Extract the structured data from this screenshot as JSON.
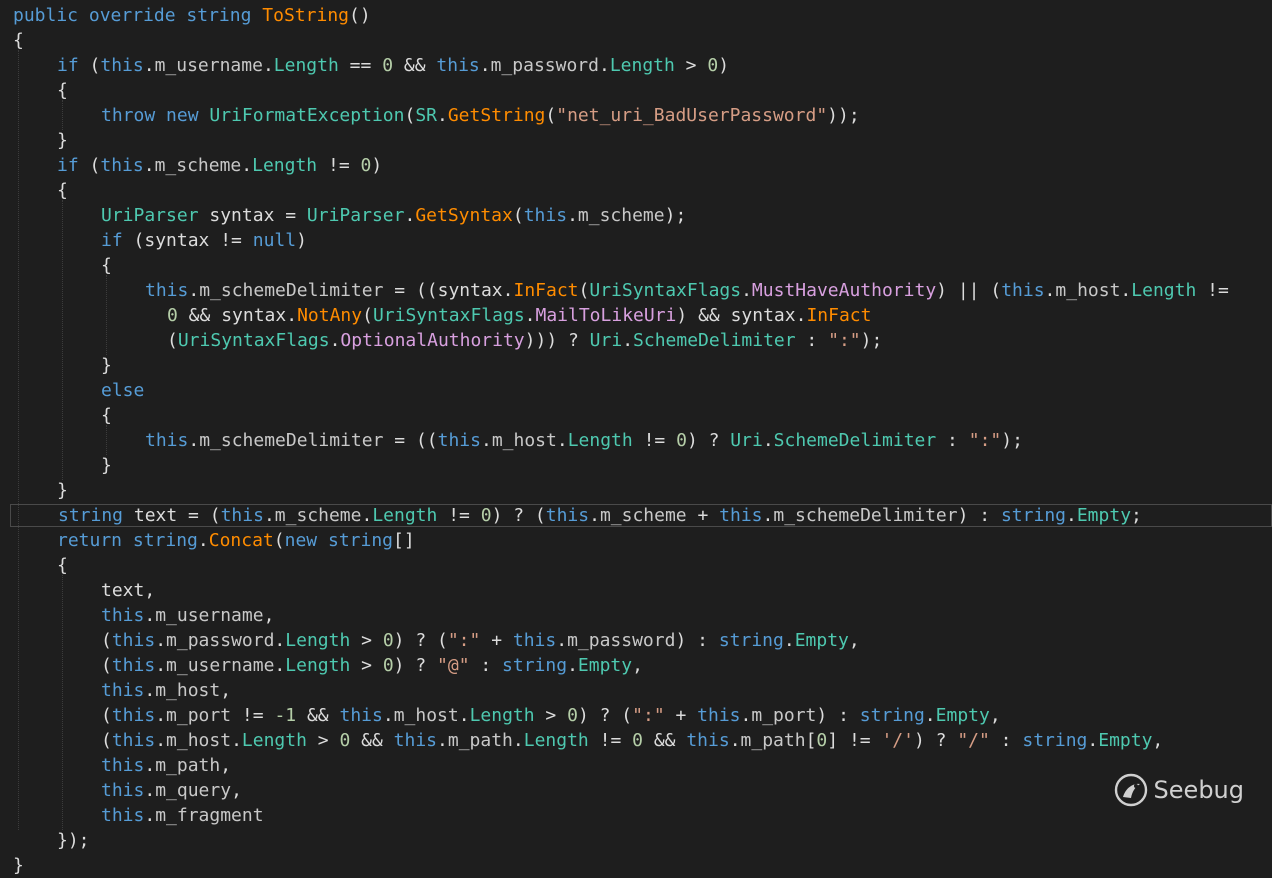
{
  "editor": {
    "current_line": 20,
    "lines": [
      {
        "indent": 0,
        "tokens": [
          [
            "kw",
            "public"
          ],
          [
            "punc",
            " "
          ],
          [
            "kw",
            "override"
          ],
          [
            "punc",
            " "
          ],
          [
            "kw",
            "string"
          ],
          [
            "punc",
            " "
          ],
          [
            "method",
            "ToString"
          ],
          [
            "punc",
            "()"
          ]
        ]
      },
      {
        "indent": 0,
        "tokens": [
          [
            "punc",
            "{"
          ]
        ]
      },
      {
        "indent": 1,
        "tokens": [
          [
            "kw",
            "if"
          ],
          [
            "punc",
            " ("
          ],
          [
            "kw",
            "this"
          ],
          [
            "punc",
            "."
          ],
          [
            "field",
            "m_username"
          ],
          [
            "punc",
            "."
          ],
          [
            "prop",
            "Length"
          ],
          [
            "punc",
            " == "
          ],
          [
            "num",
            "0"
          ],
          [
            "punc",
            " && "
          ],
          [
            "kw",
            "this"
          ],
          [
            "punc",
            "."
          ],
          [
            "field",
            "m_password"
          ],
          [
            "punc",
            "."
          ],
          [
            "prop",
            "Length"
          ],
          [
            "punc",
            " > "
          ],
          [
            "num",
            "0"
          ],
          [
            "punc",
            ")"
          ]
        ]
      },
      {
        "indent": 1,
        "tokens": [
          [
            "punc",
            "{"
          ]
        ]
      },
      {
        "indent": 2,
        "tokens": [
          [
            "kw",
            "throw"
          ],
          [
            "punc",
            " "
          ],
          [
            "kw",
            "new"
          ],
          [
            "punc",
            " "
          ],
          [
            "type",
            "UriFormatException"
          ],
          [
            "punc",
            "("
          ],
          [
            "type",
            "SR"
          ],
          [
            "punc",
            "."
          ],
          [
            "method",
            "GetString"
          ],
          [
            "punc",
            "("
          ],
          [
            "str",
            "\"net_uri_BadUserPassword\""
          ],
          [
            "punc",
            "));"
          ]
        ]
      },
      {
        "indent": 1,
        "tokens": [
          [
            "punc",
            "}"
          ]
        ]
      },
      {
        "indent": 1,
        "tokens": [
          [
            "kw",
            "if"
          ],
          [
            "punc",
            " ("
          ],
          [
            "kw",
            "this"
          ],
          [
            "punc",
            "."
          ],
          [
            "field",
            "m_scheme"
          ],
          [
            "punc",
            "."
          ],
          [
            "prop",
            "Length"
          ],
          [
            "punc",
            " != "
          ],
          [
            "num",
            "0"
          ],
          [
            "punc",
            ")"
          ]
        ]
      },
      {
        "indent": 1,
        "tokens": [
          [
            "punc",
            "{"
          ]
        ]
      },
      {
        "indent": 2,
        "tokens": [
          [
            "type",
            "UriParser"
          ],
          [
            "punc",
            " syntax = "
          ],
          [
            "type",
            "UriParser"
          ],
          [
            "punc",
            "."
          ],
          [
            "method",
            "GetSyntax"
          ],
          [
            "punc",
            "("
          ],
          [
            "kw",
            "this"
          ],
          [
            "punc",
            "."
          ],
          [
            "field",
            "m_scheme"
          ],
          [
            "punc",
            ");"
          ]
        ]
      },
      {
        "indent": 2,
        "tokens": [
          [
            "kw",
            "if"
          ],
          [
            "punc",
            " (syntax != "
          ],
          [
            "kw",
            "null"
          ],
          [
            "punc",
            ")"
          ]
        ]
      },
      {
        "indent": 2,
        "tokens": [
          [
            "punc",
            "{"
          ]
        ]
      },
      {
        "indent": 3,
        "tokens": [
          [
            "kw",
            "this"
          ],
          [
            "punc",
            "."
          ],
          [
            "field",
            "m_schemeDelimiter"
          ],
          [
            "punc",
            " = ((syntax."
          ],
          [
            "method",
            "InFact"
          ],
          [
            "punc",
            "("
          ],
          [
            "type",
            "UriSyntaxFlags"
          ],
          [
            "punc",
            "."
          ],
          [
            "purple",
            "MustHaveAuthority"
          ],
          [
            "punc",
            ") || ("
          ],
          [
            "kw",
            "this"
          ],
          [
            "punc",
            "."
          ],
          [
            "field",
            "m_host"
          ],
          [
            "punc",
            "."
          ],
          [
            "prop",
            "Length"
          ],
          [
            "punc",
            " !="
          ]
        ]
      },
      {
        "indent": 3,
        "cont": true,
        "tokens": [
          [
            "num",
            "0"
          ],
          [
            "punc",
            " && syntax."
          ],
          [
            "method",
            "NotAny"
          ],
          [
            "punc",
            "("
          ],
          [
            "type",
            "UriSyntaxFlags"
          ],
          [
            "punc",
            "."
          ],
          [
            "purple",
            "MailToLikeUri"
          ],
          [
            "punc",
            ") && syntax."
          ],
          [
            "method",
            "InFact"
          ]
        ]
      },
      {
        "indent": 3,
        "cont": true,
        "tokens": [
          [
            "punc",
            "("
          ],
          [
            "type",
            "UriSyntaxFlags"
          ],
          [
            "punc",
            "."
          ],
          [
            "purple",
            "OptionalAuthority"
          ],
          [
            "punc",
            "))) ? "
          ],
          [
            "type",
            "Uri"
          ],
          [
            "punc",
            "."
          ],
          [
            "type",
            "SchemeDelimiter"
          ],
          [
            "punc",
            " : "
          ],
          [
            "str",
            "\":\""
          ],
          [
            "punc",
            ");"
          ]
        ]
      },
      {
        "indent": 2,
        "tokens": [
          [
            "punc",
            "}"
          ]
        ]
      },
      {
        "indent": 2,
        "tokens": [
          [
            "kw",
            "else"
          ]
        ]
      },
      {
        "indent": 2,
        "tokens": [
          [
            "punc",
            "{"
          ]
        ]
      },
      {
        "indent": 3,
        "tokens": [
          [
            "kw",
            "this"
          ],
          [
            "punc",
            "."
          ],
          [
            "field",
            "m_schemeDelimiter"
          ],
          [
            "punc",
            " = (("
          ],
          [
            "kw",
            "this"
          ],
          [
            "punc",
            "."
          ],
          [
            "field",
            "m_host"
          ],
          [
            "punc",
            "."
          ],
          [
            "prop",
            "Length"
          ],
          [
            "punc",
            " != "
          ],
          [
            "num",
            "0"
          ],
          [
            "punc",
            ") ? "
          ],
          [
            "type",
            "Uri"
          ],
          [
            "punc",
            "."
          ],
          [
            "type",
            "SchemeDelimiter"
          ],
          [
            "punc",
            " : "
          ],
          [
            "str",
            "\":\""
          ],
          [
            "punc",
            ");"
          ]
        ]
      },
      {
        "indent": 2,
        "tokens": [
          [
            "punc",
            "}"
          ]
        ]
      },
      {
        "indent": 1,
        "tokens": [
          [
            "punc",
            "}"
          ]
        ]
      },
      {
        "indent": 1,
        "tokens": [
          [
            "kw",
            "string"
          ],
          [
            "punc",
            " text = ("
          ],
          [
            "kw",
            "this"
          ],
          [
            "punc",
            "."
          ],
          [
            "field",
            "m_scheme"
          ],
          [
            "punc",
            "."
          ],
          [
            "prop",
            "Length"
          ],
          [
            "punc",
            " != "
          ],
          [
            "num",
            "0"
          ],
          [
            "punc",
            ") ? ("
          ],
          [
            "kw",
            "this"
          ],
          [
            "punc",
            "."
          ],
          [
            "field",
            "m_scheme"
          ],
          [
            "punc",
            " + "
          ],
          [
            "kw",
            "this"
          ],
          [
            "punc",
            "."
          ],
          [
            "field",
            "m_schemeDelimiter"
          ],
          [
            "punc",
            ") : "
          ],
          [
            "kw",
            "string"
          ],
          [
            "punc",
            "."
          ],
          [
            "prop",
            "Empty"
          ],
          [
            "punc",
            ";"
          ]
        ]
      },
      {
        "indent": 1,
        "tokens": [
          [
            "kw",
            "return"
          ],
          [
            "punc",
            " "
          ],
          [
            "kw",
            "string"
          ],
          [
            "punc",
            "."
          ],
          [
            "method",
            "Concat"
          ],
          [
            "punc",
            "("
          ],
          [
            "kw",
            "new"
          ],
          [
            "punc",
            " "
          ],
          [
            "kw",
            "string"
          ],
          [
            "punc",
            "[]"
          ]
        ]
      },
      {
        "indent": 1,
        "tokens": [
          [
            "punc",
            "{"
          ]
        ]
      },
      {
        "indent": 2,
        "tokens": [
          [
            "punc",
            "text,"
          ]
        ]
      },
      {
        "indent": 2,
        "tokens": [
          [
            "kw",
            "this"
          ],
          [
            "punc",
            "."
          ],
          [
            "field",
            "m_username"
          ],
          [
            "punc",
            ","
          ]
        ]
      },
      {
        "indent": 2,
        "tokens": [
          [
            "punc",
            "("
          ],
          [
            "kw",
            "this"
          ],
          [
            "punc",
            "."
          ],
          [
            "field",
            "m_password"
          ],
          [
            "punc",
            "."
          ],
          [
            "prop",
            "Length"
          ],
          [
            "punc",
            " > "
          ],
          [
            "num",
            "0"
          ],
          [
            "punc",
            ") ? ("
          ],
          [
            "str",
            "\":\""
          ],
          [
            "punc",
            " + "
          ],
          [
            "kw",
            "this"
          ],
          [
            "punc",
            "."
          ],
          [
            "field",
            "m_password"
          ],
          [
            "punc",
            ") : "
          ],
          [
            "kw",
            "string"
          ],
          [
            "punc",
            "."
          ],
          [
            "prop",
            "Empty"
          ],
          [
            "punc",
            ","
          ]
        ]
      },
      {
        "indent": 2,
        "tokens": [
          [
            "punc",
            "("
          ],
          [
            "kw",
            "this"
          ],
          [
            "punc",
            "."
          ],
          [
            "field",
            "m_username"
          ],
          [
            "punc",
            "."
          ],
          [
            "prop",
            "Length"
          ],
          [
            "punc",
            " > "
          ],
          [
            "num",
            "0"
          ],
          [
            "punc",
            ") ? "
          ],
          [
            "str",
            "\"@\""
          ],
          [
            "punc",
            " : "
          ],
          [
            "kw",
            "string"
          ],
          [
            "punc",
            "."
          ],
          [
            "prop",
            "Empty"
          ],
          [
            "punc",
            ","
          ]
        ]
      },
      {
        "indent": 2,
        "tokens": [
          [
            "kw",
            "this"
          ],
          [
            "punc",
            "."
          ],
          [
            "field",
            "m_host"
          ],
          [
            "punc",
            ","
          ]
        ]
      },
      {
        "indent": 2,
        "tokens": [
          [
            "punc",
            "("
          ],
          [
            "kw",
            "this"
          ],
          [
            "punc",
            "."
          ],
          [
            "field",
            "m_port"
          ],
          [
            "punc",
            " != "
          ],
          [
            "num",
            "-1"
          ],
          [
            "punc",
            " && "
          ],
          [
            "kw",
            "this"
          ],
          [
            "punc",
            "."
          ],
          [
            "field",
            "m_host"
          ],
          [
            "punc",
            "."
          ],
          [
            "prop",
            "Length"
          ],
          [
            "punc",
            " > "
          ],
          [
            "num",
            "0"
          ],
          [
            "punc",
            ") ? ("
          ],
          [
            "str",
            "\":\""
          ],
          [
            "punc",
            " + "
          ],
          [
            "kw",
            "this"
          ],
          [
            "punc",
            "."
          ],
          [
            "field",
            "m_port"
          ],
          [
            "punc",
            ") : "
          ],
          [
            "kw",
            "string"
          ],
          [
            "punc",
            "."
          ],
          [
            "prop",
            "Empty"
          ],
          [
            "punc",
            ","
          ]
        ]
      },
      {
        "indent": 2,
        "tokens": [
          [
            "punc",
            "("
          ],
          [
            "kw",
            "this"
          ],
          [
            "punc",
            "."
          ],
          [
            "field",
            "m_host"
          ],
          [
            "punc",
            "."
          ],
          [
            "prop",
            "Length"
          ],
          [
            "punc",
            " > "
          ],
          [
            "num",
            "0"
          ],
          [
            "punc",
            " && "
          ],
          [
            "kw",
            "this"
          ],
          [
            "punc",
            "."
          ],
          [
            "field",
            "m_path"
          ],
          [
            "punc",
            "."
          ],
          [
            "prop",
            "Length"
          ],
          [
            "punc",
            " != "
          ],
          [
            "num",
            "0"
          ],
          [
            "punc",
            " && "
          ],
          [
            "kw",
            "this"
          ],
          [
            "punc",
            "."
          ],
          [
            "field",
            "m_path"
          ],
          [
            "punc",
            "["
          ],
          [
            "num",
            "0"
          ],
          [
            "punc",
            "] != "
          ],
          [
            "str",
            "'/'"
          ],
          [
            "punc",
            ") ? "
          ],
          [
            "str",
            "\"/\""
          ],
          [
            "punc",
            " : "
          ],
          [
            "kw",
            "string"
          ],
          [
            "punc",
            "."
          ],
          [
            "prop",
            "Empty"
          ],
          [
            "punc",
            ","
          ]
        ]
      },
      {
        "indent": 2,
        "tokens": [
          [
            "kw",
            "this"
          ],
          [
            "punc",
            "."
          ],
          [
            "field",
            "m_path"
          ],
          [
            "punc",
            ","
          ]
        ]
      },
      {
        "indent": 2,
        "tokens": [
          [
            "kw",
            "this"
          ],
          [
            "punc",
            "."
          ],
          [
            "field",
            "m_query"
          ],
          [
            "punc",
            ","
          ]
        ]
      },
      {
        "indent": 2,
        "tokens": [
          [
            "kw",
            "this"
          ],
          [
            "punc",
            "."
          ],
          [
            "field",
            "m_fragment"
          ]
        ]
      },
      {
        "indent": 1,
        "tokens": [
          [
            "punc",
            "});"
          ]
        ]
      },
      {
        "indent": 0,
        "tokens": [
          [
            "punc",
            "}"
          ]
        ]
      }
    ]
  },
  "watermark": {
    "text": "Seebug",
    "icon": "seebug-logo-icon"
  }
}
